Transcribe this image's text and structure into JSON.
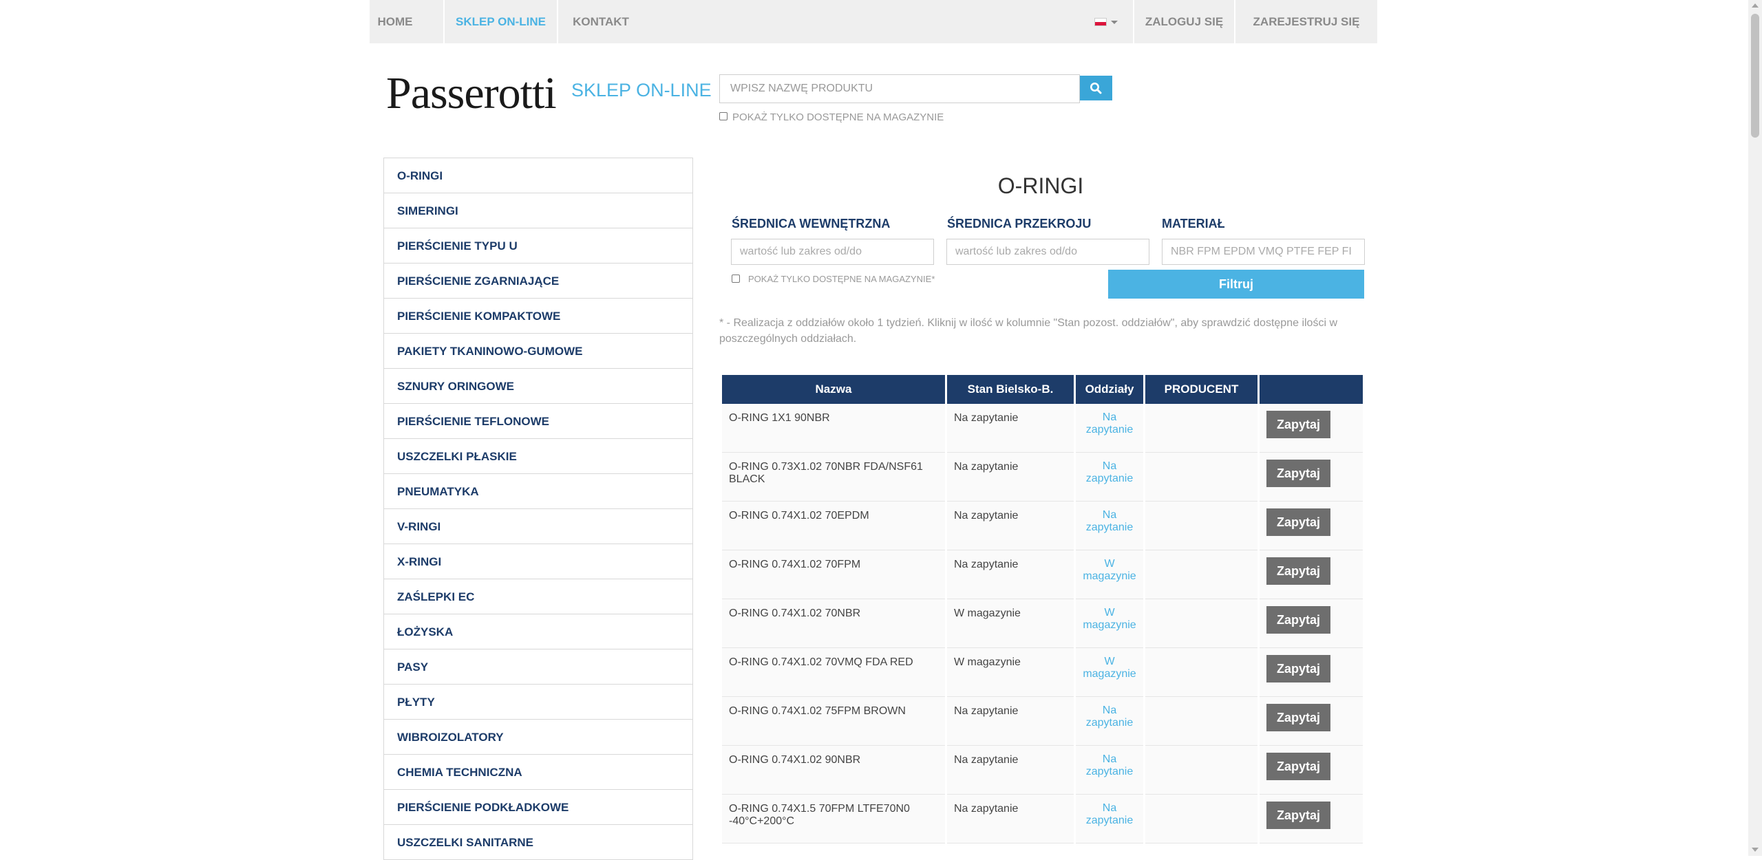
{
  "nav": {
    "home": "HOME",
    "shop": "SKLEP ON-LINE",
    "contact": "KONTAKT",
    "login": "ZALOGUJ SIĘ",
    "register": "ZAREJESTRUJ SIĘ",
    "language_icon": "poland-flag-icon"
  },
  "logo": {
    "name": "Passerotti",
    "sub": "SKLEP ON-LINE"
  },
  "search": {
    "placeholder": "WPISZ NAZWĘ PRODUKTU",
    "only_available_label": "POKAŻ TYLKO DOSTĘPNE NA MAGAZYNIE"
  },
  "sidebar": {
    "items": [
      "O-RINGI",
      "SIMERINGI",
      "PIERŚCIENIE TYPU U",
      "PIERŚCIENIE ZGARNIAJĄCE",
      "PIERŚCIENIE KOMPAKTOWE",
      "PAKIETY TKANINOWO-GUMOWE",
      "SZNURY ORINGOWE",
      "PIERŚCIENIE TEFLONOWE",
      "USZCZELKI PŁASKIE",
      "PNEUMATYKA",
      "V-RINGI",
      "X-RINGI",
      "ZAŚLEPKI EC",
      "ŁOŻYSKA",
      "PASY",
      "PŁYTY",
      "WIBROIZOLATORY",
      "CHEMIA TECHNICZNA",
      "PIERŚCIENIE PODKŁADKOWE",
      "USZCZELKI SANITARNE"
    ]
  },
  "main": {
    "title": "O-RINGI",
    "filters": {
      "inner_label": "ŚREDNICA WEWNĘTRZNA",
      "inner_placeholder": "wartość lub zakres od/do",
      "cross_label": "ŚREDNICA PRZEKROJU",
      "cross_placeholder": "wartość lub zakres od/do",
      "material_label": "MATERIAŁ",
      "material_placeholder": "NBR FPM EPDM VMQ PTFE FEP FI",
      "only_available_label": "POKAŻ TYLKO DOSTĘPNE NA MAGAZYNIE*",
      "filter_button": "Filtruj"
    },
    "note_line1": "* - Realizacja z oddziałów około 1 tydzień. Kliknij w ilość w kolumnie \"Stan pozost. oddziałów\", aby sprawdzić dostępne ilości w",
    "note_line2": "poszczególnych oddziałach."
  },
  "table": {
    "headers": {
      "name": "Nazwa",
      "stock": "Stan Bielsko-B.",
      "branches": "Oddziały",
      "producer": "PRODUCENT"
    },
    "button_label": "Zapytaj",
    "rows": [
      {
        "name_l1": "O-RING 1X1 90NBR",
        "name_l2": "",
        "stock": "Na zapytanie",
        "br_l1": "Na",
        "br_l2": "zapytanie",
        "producer": ""
      },
      {
        "name_l1": "O-RING 0.73X1.02 70NBR FDA/NSF61",
        "name_l2": "BLACK",
        "stock": "Na zapytanie",
        "br_l1": "Na",
        "br_l2": "zapytanie",
        "producer": ""
      },
      {
        "name_l1": "O-RING 0.74X1.02 70EPDM",
        "name_l2": "",
        "stock": "Na zapytanie",
        "br_l1": "Na",
        "br_l2": "zapytanie",
        "producer": ""
      },
      {
        "name_l1": "O-RING 0.74X1.02 70FPM",
        "name_l2": "",
        "stock": "Na zapytanie",
        "br_l1": "W",
        "br_l2": "magazynie",
        "producer": ""
      },
      {
        "name_l1": "O-RING 0.74X1.02 70NBR",
        "name_l2": "",
        "stock": "W magazynie",
        "br_l1": "W",
        "br_l2": "magazynie",
        "producer": ""
      },
      {
        "name_l1": "O-RING 0.74X1.02 70VMQ FDA RED",
        "name_l2": "",
        "stock": "W magazynie",
        "br_l1": "W",
        "br_l2": "magazynie",
        "producer": ""
      },
      {
        "name_l1": "O-RING 0.74X1.02 75FPM BROWN",
        "name_l2": "",
        "stock": "Na zapytanie",
        "br_l1": "Na",
        "br_l2": "zapytanie",
        "producer": ""
      },
      {
        "name_l1": "O-RING 0.74X1.02 90NBR",
        "name_l2": "",
        "stock": "Na zapytanie",
        "br_l1": "Na",
        "br_l2": "zapytanie",
        "producer": ""
      },
      {
        "name_l1": "O-RING 0.74X1.5 70FPM LTFE70N0",
        "name_l2": "-40°C+200°C",
        "stock": "Na zapytanie",
        "br_l1": "Na",
        "br_l2": "zapytanie",
        "producer": ""
      }
    ]
  },
  "colors": {
    "accent": "#4bb3e3",
    "navy": "#1d3c69",
    "button_grey": "#6e6e6e"
  }
}
